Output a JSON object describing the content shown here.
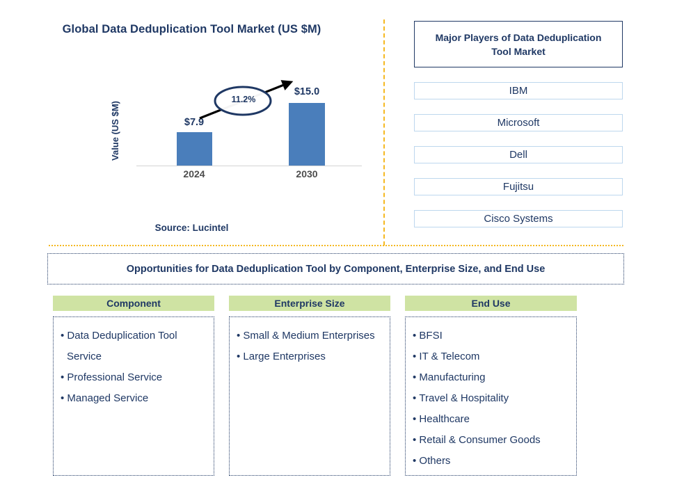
{
  "chart_panel": {
    "title": "Global Data Deduplication Tool Market (US $M)",
    "ylabel": "Value (US $M)",
    "cagr_label": "11.2%",
    "source": "Source: Lucintel"
  },
  "chart_data": {
    "type": "bar",
    "title": "Global Data Deduplication Tool Market (US $M)",
    "categories": [
      "2024",
      "2030"
    ],
    "values": [
      7.9,
      15.0
    ],
    "value_labels": [
      "$7.9",
      "$15.0"
    ],
    "xlabel": "",
    "ylabel": "Value (US $M)",
    "ylim": [
      0,
      17
    ],
    "grid": false,
    "legend": "none",
    "bar_color": "#4a7ebb",
    "annotations": [
      {
        "type": "cagr-arrow",
        "text": "11.2%",
        "from": "2024",
        "to": "2030"
      }
    ],
    "source": "Source: Lucintel"
  },
  "players": {
    "header": "Major Players of Data Deduplication Tool Market",
    "items": [
      {
        "name": "IBM"
      },
      {
        "name": "Microsoft"
      },
      {
        "name": "Dell"
      },
      {
        "name": "Fujitsu"
      },
      {
        "name": "Cisco Systems"
      }
    ]
  },
  "opportunities": {
    "banner": "Opportunities for Data Deduplication Tool by Component, Enterprise Size, and End Use",
    "columns": [
      {
        "header": "Component",
        "items": [
          "Data Deduplication Tool Service",
          "Professional Service",
          "Managed Service"
        ]
      },
      {
        "header": "Enterprise Size",
        "items": [
          "Small & Medium Enterprises",
          "Large Enterprises"
        ]
      },
      {
        "header": "End Use",
        "items": [
          "BFSI",
          "IT & Telecom",
          "Manufacturing",
          "Travel & Hospitality",
          "Healthcare",
          "Retail & Consumer Goods",
          "Others"
        ]
      }
    ]
  },
  "colors": {
    "navy": "#1f3864",
    "bar_blue": "#4a7ebb",
    "divider_amber": "#f5b820",
    "header_green": "#cfe3a3",
    "player_border": "#bdd7ee"
  }
}
